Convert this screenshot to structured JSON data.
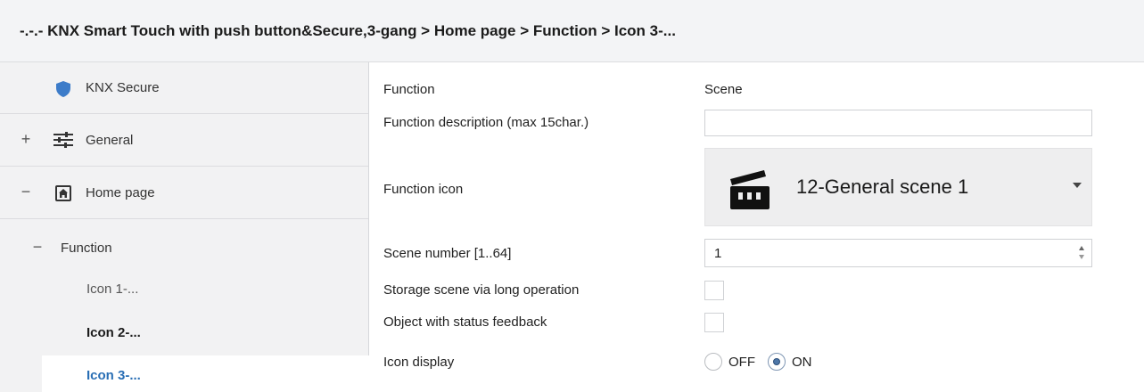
{
  "title": "-.-.- KNX Smart Touch with push button&Secure,3-gang > Home page > Function > Icon 3-...",
  "sidebar": {
    "items": [
      {
        "label": "KNX Secure",
        "toggle": ""
      },
      {
        "label": "General",
        "toggle": "+"
      },
      {
        "label": "Home page",
        "toggle": "−"
      },
      {
        "label": "Function",
        "toggle": "−"
      },
      {
        "label": "Icon 1-...",
        "toggle": ""
      },
      {
        "label": "Icon 2-...",
        "toggle": ""
      },
      {
        "label": "Icon 3-...",
        "toggle": ""
      }
    ],
    "icons": [
      "shield-icon",
      "sliders-icon",
      "home-icon"
    ]
  },
  "params": {
    "function": {
      "label": "Function",
      "value": "Scene"
    },
    "description": {
      "label": "Function description (max 15char.)",
      "value": ""
    },
    "icon": {
      "label": "Function icon",
      "selected": "12-General scene 1",
      "icon": "clapperboard-icon"
    },
    "scene_number": {
      "label": "Scene number [1..64]",
      "value": "1"
    },
    "storage": {
      "label": "Storage scene via long operation",
      "checked": false
    },
    "feedback": {
      "label": "Object with status feedback",
      "checked": false
    },
    "icon_display": {
      "label": "Icon display",
      "options": [
        "OFF",
        "ON"
      ],
      "selected": "ON"
    }
  },
  "colors": {
    "accent": "#2a6fb5",
    "shield": "#3d7cc9",
    "sidebar_bg": "#f2f2f3",
    "header_bg": "#f3f4f6"
  }
}
